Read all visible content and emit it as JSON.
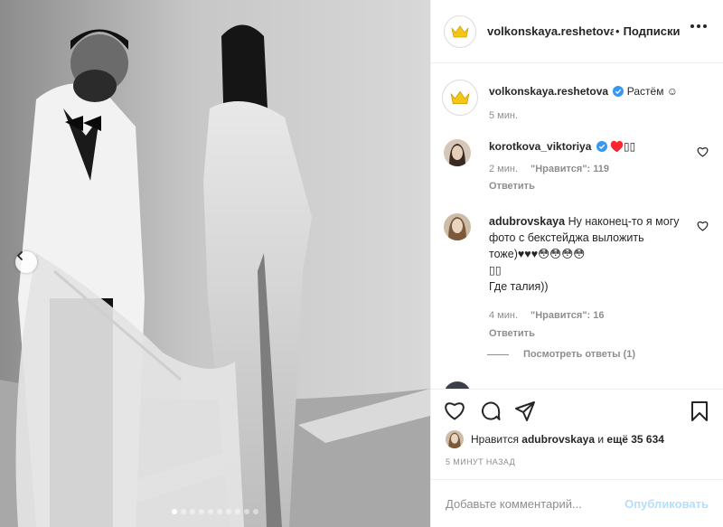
{
  "photo": {
    "carousel_dots": 10,
    "active_dot": 0
  },
  "header": {
    "username": "volkonskaya.reshetova",
    "separator": "•",
    "follow_label": "Подписки"
  },
  "caption": {
    "username": "volkonskaya.reshetova",
    "text": "Растём ☺",
    "time": "5 мин."
  },
  "comments": [
    {
      "username": "korotkova_viktoriya",
      "verified": true,
      "text": "♥️▯▯",
      "time": "2 мин.",
      "likes": "\"Нравится\": 119",
      "reply": "Ответить"
    },
    {
      "username": "adubrovskaya",
      "verified": false,
      "text": "Ну наконец-то я могу фото с бекстейджа выложить тоже)♥♥♥😳😳😳😳",
      "text_line2": "▯▯",
      "text_line3": "Где талия))",
      "time": "4 мин.",
      "likes": "\"Нравится\": 16",
      "reply": "Ответить"
    }
  ],
  "view_replies": "Посмотреть ответы (1)",
  "likes_line": {
    "prefix": "Нравится",
    "user": "adubrovskaya",
    "middle": "и",
    "count": "ещё 35 634"
  },
  "posted_ago": "5 МИНУТ НАЗАД",
  "composer": {
    "placeholder": "Добавьте комментарий...",
    "publish_label": "Опубликовать"
  },
  "colors": {
    "accent_blue": "#0095f6",
    "publish_disabled": "#b2dffc",
    "crown_gold": "#f5c518",
    "muted": "#8e8e8e"
  }
}
